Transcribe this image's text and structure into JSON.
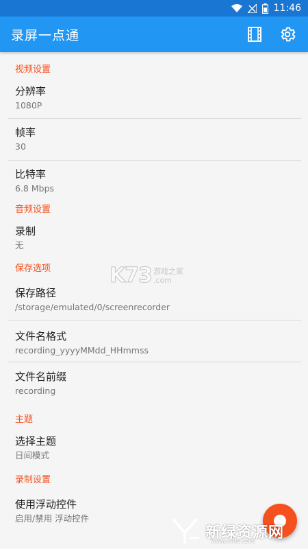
{
  "status_bar": {
    "time": "11:46",
    "icons": [
      "wifi-icon",
      "no-signal-icon",
      "battery-icon"
    ]
  },
  "app_bar": {
    "title": "录屏一点通",
    "actions": [
      "film-icon",
      "gear-icon"
    ]
  },
  "sections": {
    "video": {
      "header": "视频设置",
      "resolution": {
        "title": "分辨率",
        "summary": "1080P"
      },
      "framerate": {
        "title": "帧率",
        "summary": "30"
      },
      "bitrate": {
        "title": "比特率",
        "summary": "6.8 Mbps"
      }
    },
    "audio": {
      "header": "音频设置",
      "record": {
        "title": "录制",
        "summary": "无"
      }
    },
    "save": {
      "header": "保存选项",
      "path": {
        "title": "保存路径",
        "summary": "/storage/emulated/0/screenrecorder"
      },
      "filename_format": {
        "title": "文件名格式",
        "summary": "recording_yyyyMMdd_HHmmss"
      },
      "filename_prefix": {
        "title": "文件名前缀",
        "summary": "recording"
      }
    },
    "theme": {
      "header": "主题",
      "select": {
        "title": "选择主题",
        "summary": "日间模式"
      }
    },
    "recording": {
      "header": "录制设置",
      "floating": {
        "title": "使用浮动控件",
        "summary": "启用/禁用 浮动控件"
      }
    }
  },
  "watermarks": {
    "center_logo": "K73",
    "center_cn": "游戏之家",
    "center_com": ".com",
    "bottom_brand": "新绿资源网",
    "bottom_url": "www.xlhs.com"
  },
  "colors": {
    "status_bar": "#1976d2",
    "app_bar": "#2196f3",
    "section_header": "#f4511e",
    "fab": "#f4511e",
    "background": "#f5f5f5"
  }
}
